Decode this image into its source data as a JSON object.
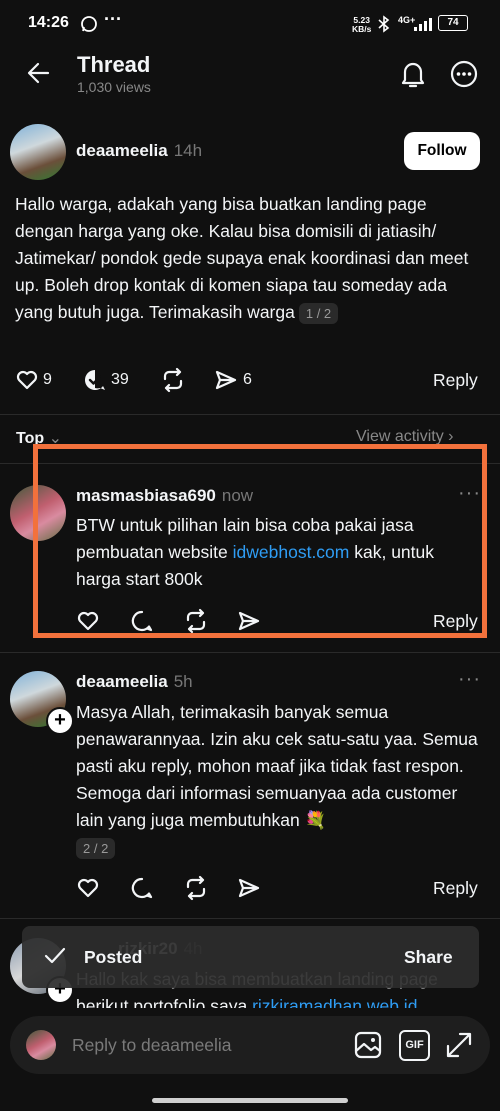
{
  "status_bar": {
    "time": "14:26",
    "net_speed": "5.23",
    "net_unit": "KB/s",
    "network": "4G+",
    "battery": "74"
  },
  "header": {
    "title": "Thread",
    "views": "1,030 views"
  },
  "main_post": {
    "username": "deaameelia",
    "time": "14h",
    "follow_label": "Follow",
    "text": "Hallo warga, adakah yang bisa buatkan landing page dengan harga yang oke. Kalau bisa domisili di jatiasih/ Jatimekar/ pondok gede supaya enak koordinasi dan meet up. Boleh drop kontak di komen siapa tau someday ada yang butuh juga. Terimakasih warga",
    "pager": "1 / 2",
    "likes": "9",
    "replies": "39",
    "shares": "6",
    "reply_label": "Reply"
  },
  "filter": {
    "sort_label": "Top",
    "activity_label": "View activity"
  },
  "replies": [
    {
      "username": "masmasbiasa690",
      "time": "now",
      "text_before": "BTW untuk pilihan lain bisa coba pakai jasa pembuatan website ",
      "link": "idwebhost.com",
      "text_after": " kak, untuk harga start 800k",
      "reply_label": "Reply",
      "highlight_color": "#f2713c"
    },
    {
      "username": "deaameelia",
      "time": "5h",
      "text": "Masya Allah, terimakasih banyak semua penawarannyaa. Izin aku cek satu-satu yaa. Semua pasti aku reply, mohon maaf jika tidak fast respon. Semoga dari informasi semuanyaa ada customer lain yang juga membutuhkan 💐",
      "pager": "2 / 2",
      "reply_label": "Reply"
    },
    {
      "username": "rizkir20",
      "time": "4h",
      "text_before": "Hallo kak saya bisa membuatkan landing page berikut portofolio saya ",
      "link": "rizkiramadhan.web.id"
    }
  ],
  "toast": {
    "status": "Posted",
    "action": "Share"
  },
  "composer": {
    "placeholder": "Reply to deaameelia",
    "gif_label": "GIF"
  }
}
